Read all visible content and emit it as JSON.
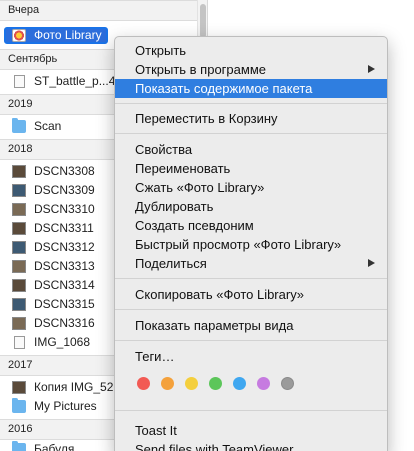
{
  "finder": {
    "sections": [
      {
        "label": "Вчера",
        "items": [
          {
            "name": "Фото Library",
            "icon": "photos-library-icon",
            "selected": true
          }
        ]
      },
      {
        "label": "Сентябрь",
        "items": [
          {
            "name": "ST_battle_p...4",
            "icon": "document-icon"
          }
        ]
      },
      {
        "label": "2019",
        "items": [
          {
            "name": "Scan",
            "icon": "folder-icon"
          }
        ]
      },
      {
        "label": "2018",
        "items": [
          {
            "name": "DSCN3308",
            "icon": "photo-icon"
          },
          {
            "name": "DSCN3309",
            "icon": "photo-icon"
          },
          {
            "name": "DSCN3310",
            "icon": "photo-icon"
          },
          {
            "name": "DSCN3311",
            "icon": "photo-icon"
          },
          {
            "name": "DSCN3312",
            "icon": "photo-icon"
          },
          {
            "name": "DSCN3313",
            "icon": "photo-icon"
          },
          {
            "name": "DSCN3314",
            "icon": "photo-icon"
          },
          {
            "name": "DSCN3315",
            "icon": "photo-icon"
          },
          {
            "name": "DSCN3316",
            "icon": "photo-icon"
          },
          {
            "name": "IMG_1068",
            "icon": "document-icon"
          }
        ]
      },
      {
        "label": "2017",
        "items": [
          {
            "name": "Копия IMG_52",
            "icon": "photo-icon"
          },
          {
            "name": "My Pictures",
            "icon": "folder-icon"
          }
        ]
      },
      {
        "label": "2016",
        "items": [
          {
            "name": "Бабуля",
            "icon": "folder-icon"
          }
        ]
      }
    ]
  },
  "context_menu": {
    "groups": [
      [
        "Открыть",
        "Открыть в программе",
        "Показать содержимое пакета"
      ],
      [
        "Переместить в Корзину"
      ],
      [
        "Свойства",
        "Переименовать",
        "Сжать «Фото Library»",
        "Дублировать",
        "Создать псевдоним",
        "Быстрый просмотр «Фото Library»",
        "Поделиться"
      ],
      [
        "Скопировать «Фото Library»"
      ],
      [
        "Показать параметры вида"
      ],
      [
        "Теги…"
      ],
      [
        "Toast It",
        "Send files with TeamViewer"
      ]
    ],
    "open_with": "Открыть в программе",
    "share": "Поделиться",
    "highlighted": "Показать содержимое пакета",
    "tag_colors": [
      "#f25a54",
      "#f4a13b",
      "#f4cf3d",
      "#5cc65a",
      "#3fa7f0",
      "#c67be0",
      "#9a9a9a"
    ],
    "highlight_color": "#2f7ee0"
  }
}
